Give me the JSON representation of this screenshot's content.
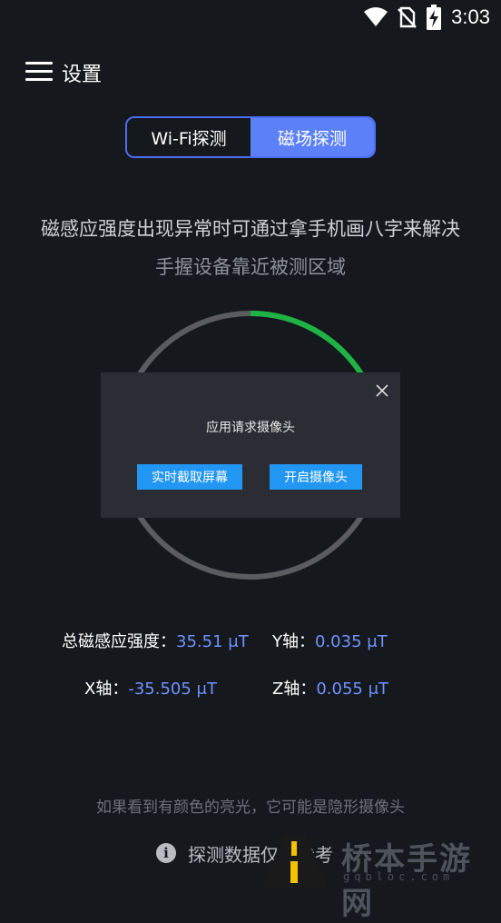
{
  "status_bar": {
    "time": "3:03",
    "icons": [
      "wifi-icon",
      "no-sim-icon",
      "battery-charging-icon"
    ]
  },
  "app_bar": {
    "menu_icon": "hamburger-menu-icon",
    "title": "设置"
  },
  "mode_tabs": [
    {
      "label": "Wi-Fi探测",
      "selected": false
    },
    {
      "label": "磁场探测",
      "selected": true
    }
  ],
  "instructions": {
    "line1": "磁感应强度出现异常时可通过拿手机画八字来解决",
    "line2": "手握设备靠近被测区域"
  },
  "gauge": {
    "track_color": "#5a5c60",
    "progress_color": "#1db444",
    "progress_fraction": 0.16
  },
  "dialog": {
    "title": "应用请求摄像头",
    "buttons": [
      "实时截取屏幕",
      "开启摄像头"
    ],
    "button_color": "#2196f3"
  },
  "readings": {
    "total": {
      "label": "总磁感应强度：",
      "value": "35.51 μT"
    },
    "y": {
      "label": "Y轴：",
      "value": "0.035 μT"
    },
    "x": {
      "label": "X轴：",
      "value": "-35.505 μT"
    },
    "z": {
      "label": "Z轴：",
      "value": "0.055 μT"
    }
  },
  "hint": "如果看到有颜色的亮光，它可能是隐形摄像头",
  "footer": {
    "icon": "info-icon",
    "text": "探测数据仅供参考"
  },
  "watermark": {
    "text": "桥本手游网",
    "url": "gqbloc.com"
  },
  "colors": {
    "background": "#15181d",
    "accent": "#5c80f7",
    "value_text": "#6f93ff"
  }
}
